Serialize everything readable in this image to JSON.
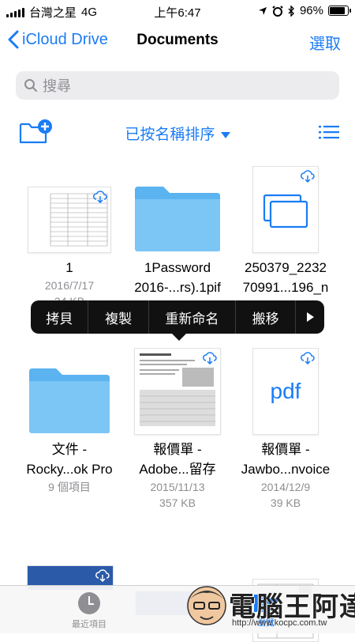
{
  "status_bar": {
    "carrier": "台灣之星",
    "network": "4G",
    "time": "上午6:47",
    "battery": "96%",
    "battery_level": 0.96
  },
  "nav": {
    "back_label": "iCloud Drive",
    "title": "Documents",
    "select_label": "選取"
  },
  "search": {
    "placeholder": "搜尋"
  },
  "sort": {
    "label": "已按名稱排序"
  },
  "items": [
    {
      "name": "1",
      "date": "2016/7/17",
      "size": "24 KB"
    },
    {
      "name_line1": "1Password",
      "name_line2": "2016-...rs).1pif"
    },
    {
      "name_line1": "250379_2232",
      "name_line2": "70991...196_n"
    },
    {
      "name_line1": "文件 -",
      "name_line2": "Rocky...ok Pro",
      "info": "9 個項目"
    },
    {
      "name_line1": "報價單 -",
      "name_line2": "Adobe...留存",
      "date": "2015/11/13",
      "size": "357 KB"
    },
    {
      "name_line1": "報價單 -",
      "name_line2": "Jawbo...nvoice",
      "date": "2014/12/9",
      "size": "39 KB",
      "thumb_text": "pdf"
    }
  ],
  "popover": {
    "options": [
      "拷貝",
      "複製",
      "重新命名",
      "搬移"
    ]
  },
  "tabs": {
    "recent": "最近項目",
    "browse": "瀏覽"
  },
  "watermark": {
    "name": "電腦王阿達",
    "url": "http://www.kocpc.com.tw"
  },
  "colors": {
    "accent": "#1a7cf5",
    "folder": "#7cc6f6"
  }
}
